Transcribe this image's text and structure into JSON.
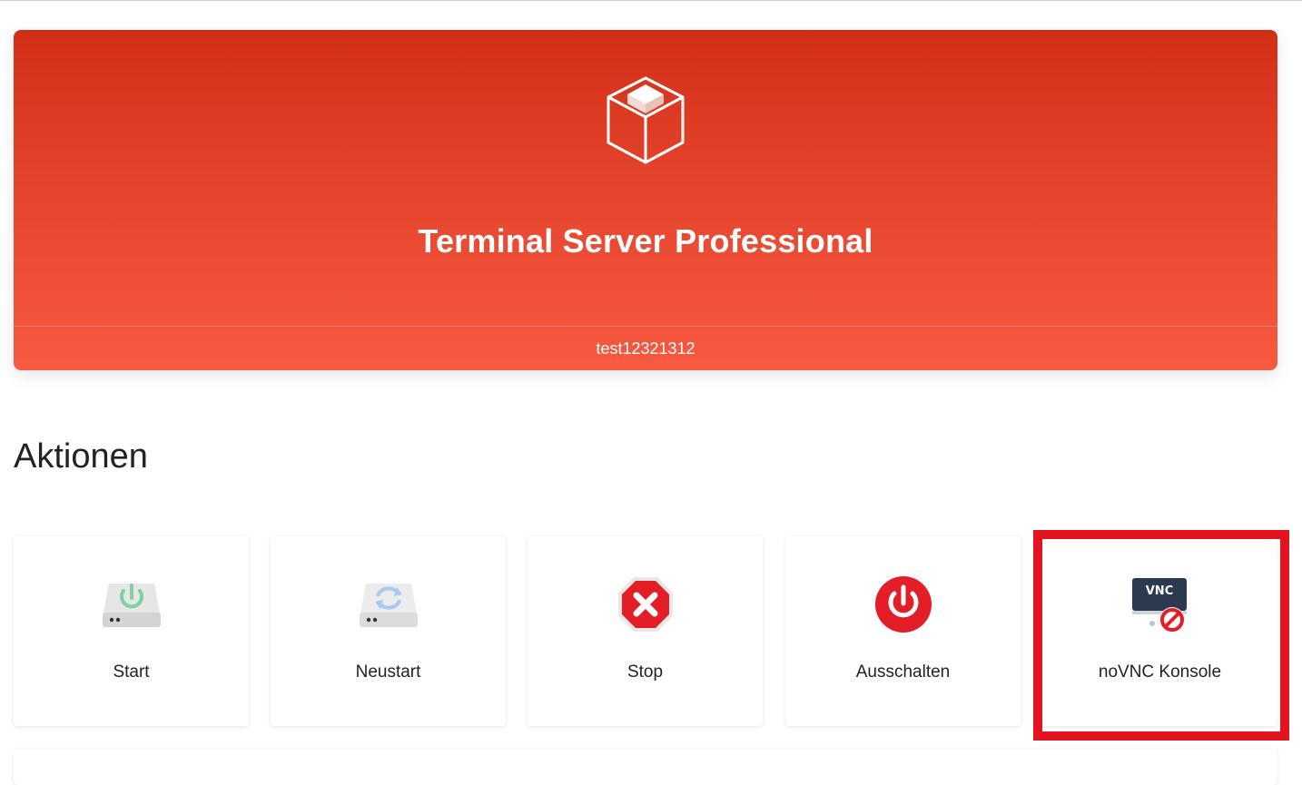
{
  "hero": {
    "title": "Terminal Server Professional",
    "footer": "test12321312",
    "icon": "box-icon",
    "gradient_top": "#d22e16",
    "gradient_bottom": "#f75a40"
  },
  "actions": {
    "title": "Aktionen",
    "items": [
      {
        "label": "Start",
        "icon": "drive-power-icon",
        "accent": "#7dd3a0"
      },
      {
        "label": "Neustart",
        "icon": "drive-refresh-icon",
        "accent": "#a9c8f2"
      },
      {
        "label": "Stop",
        "icon": "stop-octagon-icon",
        "accent": "#e41e26"
      },
      {
        "label": "Ausschalten",
        "icon": "power-off-icon",
        "accent": "#e41e26"
      },
      {
        "label": "noVNC Konsole",
        "icon": "vnc-disabled-icon",
        "badge": "VNC",
        "accent": "#e41e26"
      }
    ],
    "highlight_color": "#e31420"
  }
}
